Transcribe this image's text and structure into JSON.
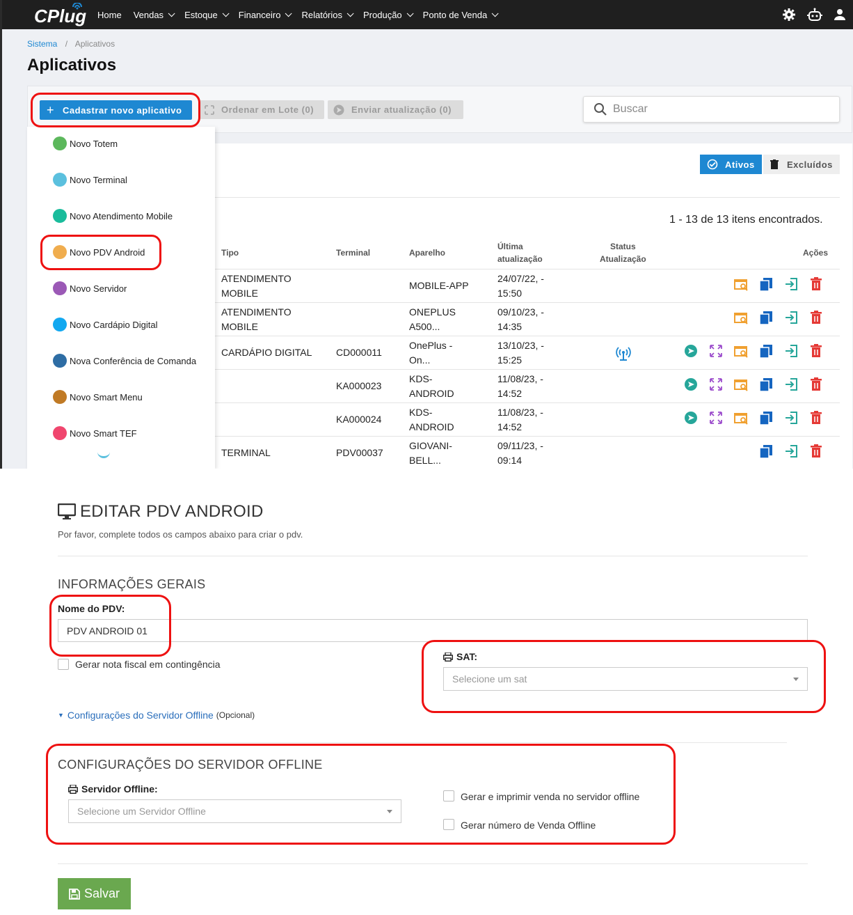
{
  "nav": {
    "logo": "CPlug",
    "items": [
      "Home",
      "Vendas",
      "Estoque",
      "Financeiro",
      "Relatórios",
      "Produção",
      "Ponto de Venda"
    ]
  },
  "breadcrumb": {
    "root": "Sistema",
    "sep": "/",
    "current": "Aplicativos"
  },
  "page_title": "Aplicativos",
  "toolbar": {
    "new_app": "Cadastrar novo aplicativo",
    "batch_order": "Ordenar em Lote (0)",
    "send_update": "Enviar atualização (0)",
    "search_placeholder": "Buscar"
  },
  "new_app_menu": [
    {
      "label": "Novo Totem",
      "color": "#5cb85c"
    },
    {
      "label": "Novo Terminal",
      "color": "#5bc0de"
    },
    {
      "label": "Novo Atendimento Mobile",
      "color": "#1abc9c"
    },
    {
      "label": "Novo PDV Android",
      "color": "#f0ad4e"
    },
    {
      "label": "Novo Servidor",
      "color": "#9b59b6"
    },
    {
      "label": "Novo Cardápio Digital",
      "color": "#12a8f0"
    },
    {
      "label": "Nova Conferência de Comanda",
      "color": "#2e6da4"
    },
    {
      "label": "Novo Smart Menu",
      "color": "#c07a25"
    },
    {
      "label": "Novo Smart TEF",
      "color": "#f0466e"
    }
  ],
  "filters": {
    "active": "Ativos",
    "deleted": "Excluídos"
  },
  "count_text": "1 - 13 de 13 itens encontrados.",
  "table": {
    "headers": {
      "tipo": "Tipo",
      "terminal": "Terminal",
      "aparelho": "Aparelho",
      "ultima1": "Última",
      "ultima2": "atualização",
      "status1": "Status",
      "status2": "Atualização",
      "acoes": "Ações"
    },
    "rows": [
      {
        "tipo1": "ATENDIMENTO",
        "tipo2": "MOBILE",
        "terminal": "",
        "aparelho1": "MOBILE-APP",
        "aparelho2": "",
        "data1": "24/07/22, -",
        "data2": "15:50"
      },
      {
        "tipo1": "ATENDIMENTO",
        "tipo2": "MOBILE",
        "terminal": "",
        "aparelho1": "ONEPLUS",
        "aparelho2": "A500...",
        "data1": "09/10/23, -",
        "data2": "14:35"
      },
      {
        "tipo1": "CARDÁPIO DIGITAL",
        "tipo2": "",
        "terminal": "CD000011",
        "aparelho1": "OnePlus -",
        "aparelho2": "On...",
        "data1": "13/10/23, -",
        "data2": "15:25"
      },
      {
        "tipo1": "",
        "tipo2": "",
        "terminal": "KA000023",
        "aparelho1": "KDS-",
        "aparelho2": "ANDROID",
        "data1": "11/08/23, -",
        "data2": "14:52"
      },
      {
        "tipo1": "",
        "tipo2": "",
        "terminal": "KA000024",
        "aparelho1": "KDS-",
        "aparelho2": "ANDROID",
        "data1": "11/08/23, -",
        "data2": "14:52"
      },
      {
        "tipo1": "TERMINAL",
        "tipo2": "",
        "terminal": "PDV00037",
        "aparelho1": "GIOVANI-",
        "aparelho2": "BELL...",
        "data1": "09/11/23, -",
        "data2": "09:14"
      }
    ]
  },
  "form": {
    "title": "EDITAR PDV ANDROID",
    "subtitle": "Por favor, complete todos os campos abaixo para criar o pdv.",
    "section_general": "INFORMAÇÕES GERAIS",
    "name_label": "Nome do PDV:",
    "name_value": "PDV ANDROID 01",
    "contingency_label": "Gerar nota fiscal em contingência",
    "sat_label": "SAT:",
    "sat_placeholder": "Selecione um sat",
    "offline_toggle": "Configurações do Servidor Offline",
    "offline_optional": "(Opcional)",
    "section_offline": "CONFIGURAÇÕES DO SERVIDOR OFFLINE",
    "offline_server_label": "Servidor Offline:",
    "offline_server_placeholder": "Selecione um Servidor Offline",
    "print_offline_label": "Gerar e imprimir venda no servidor offline",
    "offline_number_label": "Gerar número de Venda Offline",
    "save": "Salvar"
  },
  "colors": {
    "primary": "#1e88d2",
    "save": "#6aa84f",
    "highlight": "#e11111"
  }
}
